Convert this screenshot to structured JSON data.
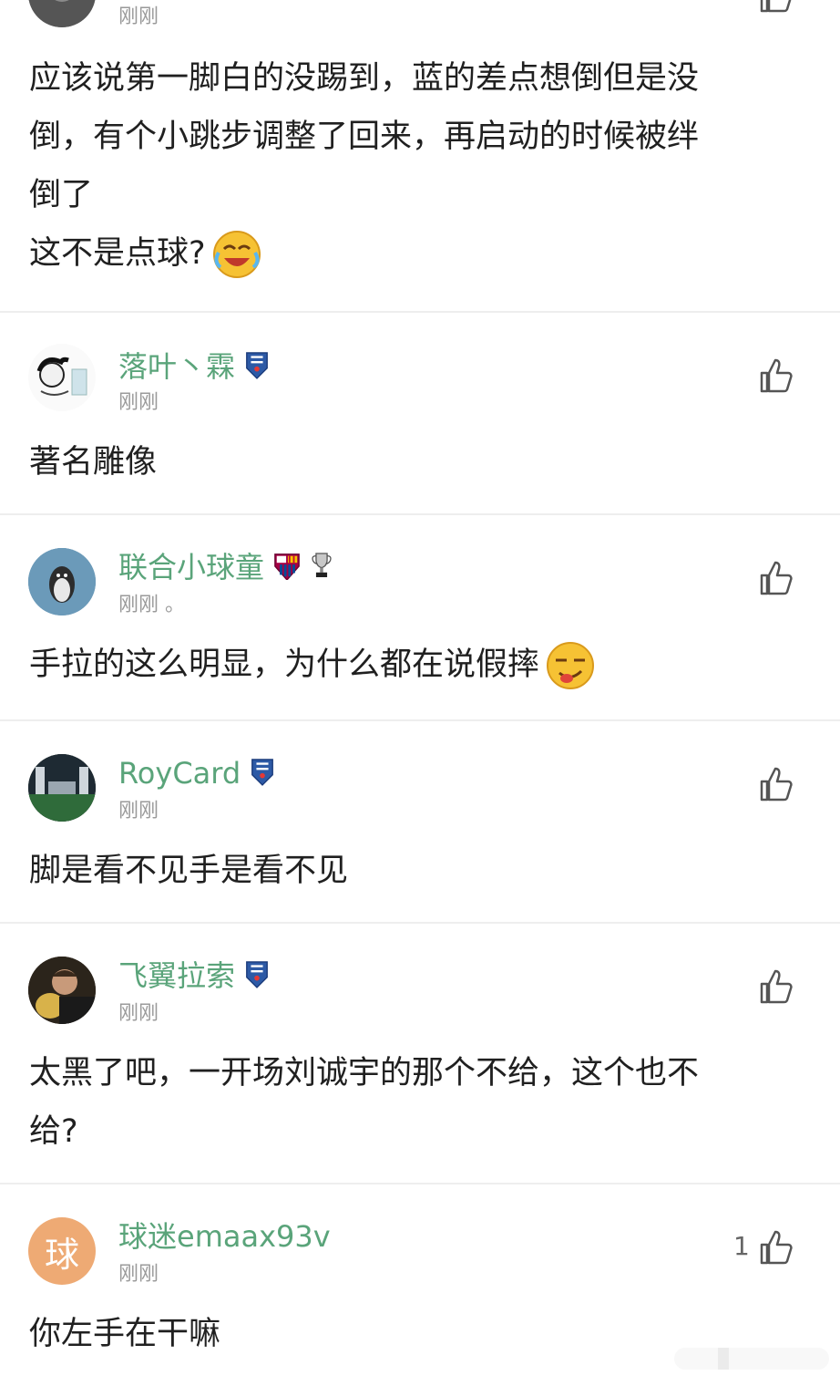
{
  "comments": [
    {
      "time": "刚刚",
      "lines": [
        "应该说第一脚白的没踢到，蓝的差点想倒但是没",
        "倒，有个小跳步调整了回来，再启动的时候被绊",
        "倒了",
        "这不是点球?"
      ]
    },
    {
      "user": "落叶丶霖",
      "time": "刚刚",
      "text": "著名雕像",
      "badges": [
        "shenhua-badge"
      ]
    },
    {
      "user": "联合小球童",
      "time": "刚刚 。",
      "text": "手拉的这么明显，为什么都在说假摔",
      "badges": [
        "barcelona-badge",
        "trophy-badge"
      ]
    },
    {
      "user": "RoyCard",
      "time": "刚刚",
      "text": "脚是看不见手是看不见",
      "badges": [
        "shenhua-badge"
      ]
    },
    {
      "user": "飞翼拉索",
      "time": "刚刚",
      "lines": [
        "太黑了吧，一开场刘诚宇的那个不给，这个也不",
        "给?"
      ],
      "badges": [
        "shenhua-badge"
      ]
    },
    {
      "user": "球迷emaax93v",
      "avatar_char": "球",
      "time": "刚刚",
      "text": "你左手在干嘛",
      "likes": "1"
    }
  ],
  "colors": {
    "username": "#5aa47a",
    "time": "#9a9a9a",
    "avatar_default": "#eeaa74"
  }
}
